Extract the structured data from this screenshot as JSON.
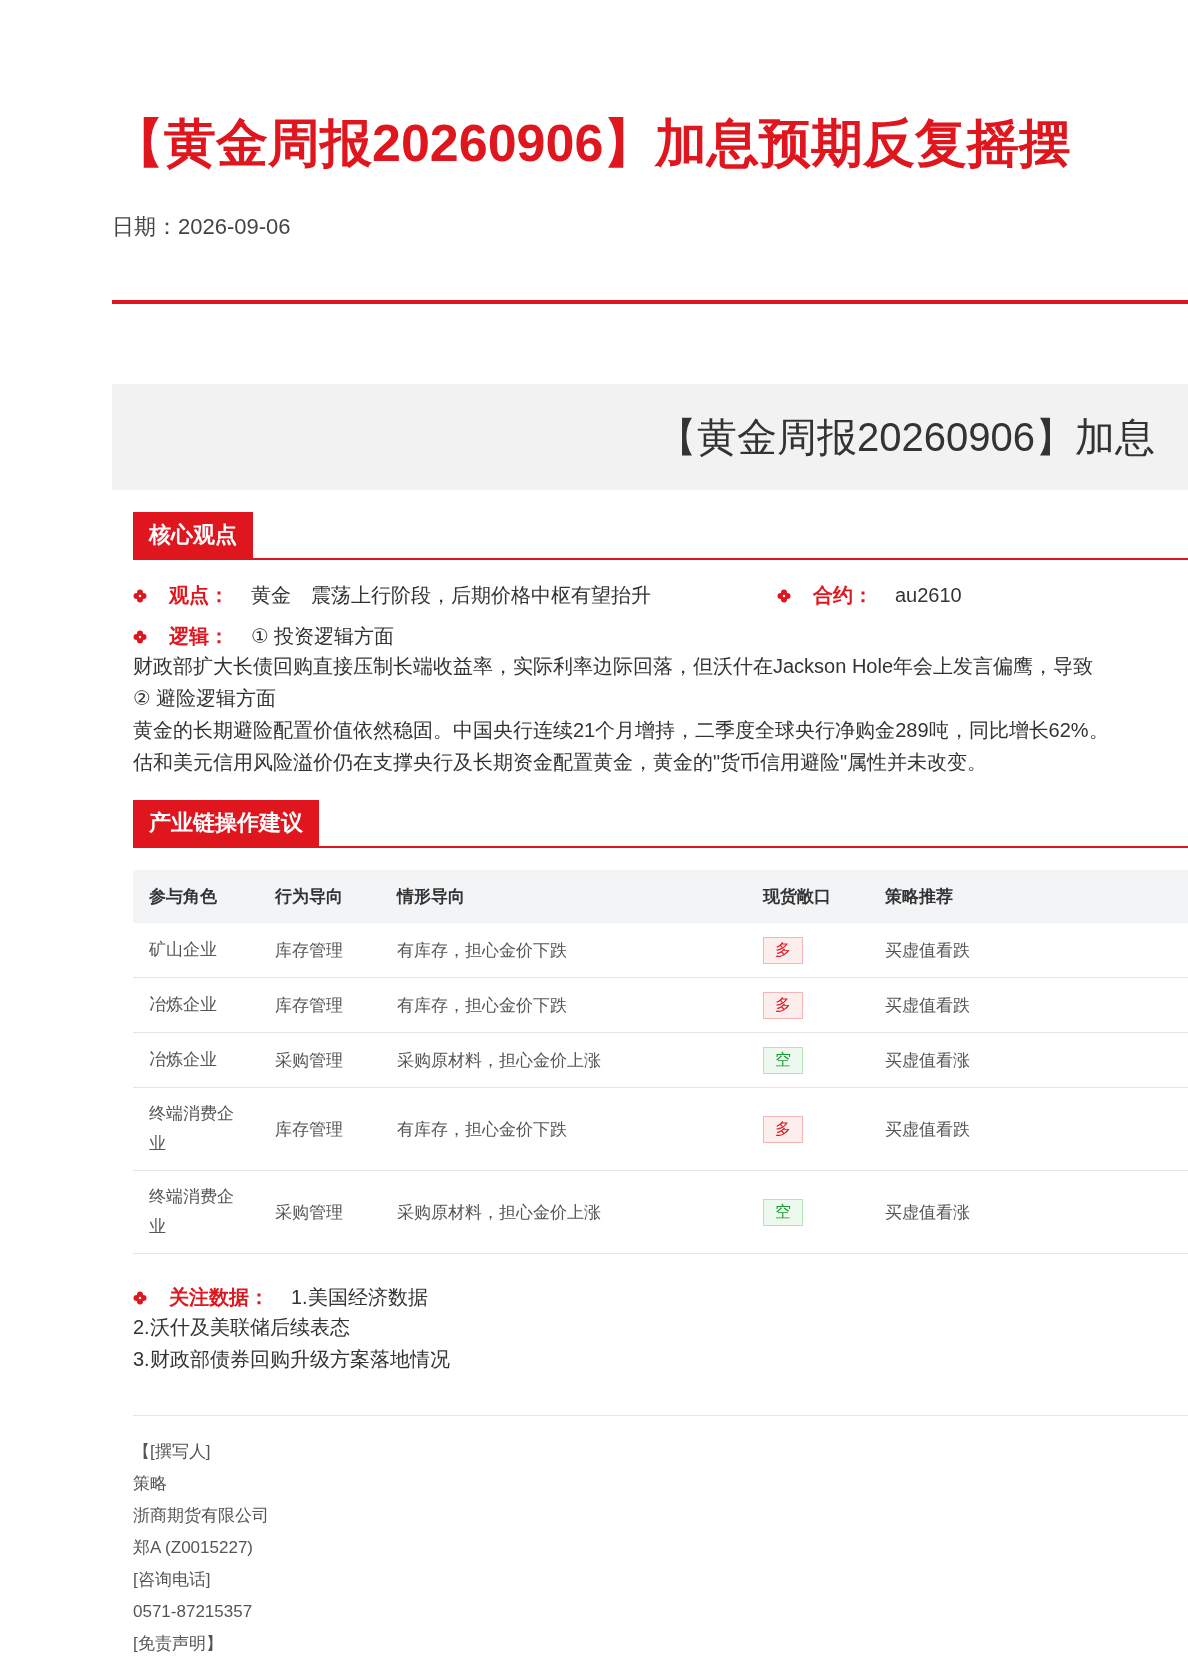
{
  "title": "【黄金周报20260906】加息预期反复摇摆",
  "date": "日期：2026-09-06",
  "banner_title": "【黄金周报20260906】加息",
  "core": {
    "heading": "核心观点",
    "view": {
      "label": "观点：",
      "subject": "黄金",
      "text": "震荡上行阶段，后期价格中枢有望抬升"
    },
    "contract": {
      "label": "合约：",
      "value": "au2610"
    },
    "logic": {
      "label": "逻辑：",
      "first": "① 投资逻辑方面",
      "lines": [
        {
          "kind": "text",
          "text": "财政部扩大长债回购直接压制长端收益率，实际利率边际回落，但沃什在Jackson Hole年会上发言偏鹰，导致"
        },
        {
          "kind": "text",
          "text": "② 避险逻辑方面"
        },
        {
          "kind": "text",
          "text": "黄金的长期避险配置价值依然稳固。中国央行连续21个月增持，二季度全球央行净购金289吨，同比增长62%。"
        },
        {
          "kind": "text",
          "text": "估和美元信用风险溢价仍在支撑央行及长期资金配置黄金，黄金的\"货币信用避险\"属性并未改变。"
        }
      ]
    }
  },
  "chain": {
    "heading": "产业链操作建议",
    "columns": [
      "参与角色",
      "行为导向",
      "情形导向",
      "现货敞口",
      "策略推荐"
    ],
    "rows": [
      {
        "role": "矿山企业",
        "behavior": "库存管理",
        "situation": "有库存，担心金价下跌",
        "exposure": {
          "text": "多",
          "kind": "long"
        },
        "strategy": "买虚值看跌"
      },
      {
        "role": "冶炼企业",
        "behavior": "库存管理",
        "situation": "有库存，担心金价下跌",
        "exposure": {
          "text": "多",
          "kind": "long"
        },
        "strategy": "买虚值看跌"
      },
      {
        "role": "冶炼企业",
        "behavior": "采购管理",
        "situation": "采购原材料，担心金价上涨",
        "exposure": {
          "text": "空",
          "kind": "short"
        },
        "strategy": "买虚值看涨"
      },
      {
        "role": "终端消费企业",
        "behavior": "库存管理",
        "situation": "有库存，担心金价下跌",
        "exposure": {
          "text": "多",
          "kind": "long"
        },
        "strategy": "买虚值看跌"
      },
      {
        "role": "终端消费企业",
        "behavior": "采购管理",
        "situation": "采购原材料，担心金价上涨",
        "exposure": {
          "text": "空",
          "kind": "short"
        },
        "strategy": "买虚值看涨"
      }
    ]
  },
  "focus": {
    "label": "关注数据：",
    "first": "1.美国经济数据",
    "items": [
      "2.沃什及美联储后续表态",
      "3.财政部债券回购升级方案落地情况"
    ]
  },
  "footer": [
    "【[撰写人]",
    "策略",
    "浙商期货有限公司",
    "郑A (Z0015227)",
    "[咨询电话]",
    "0571-87215357",
    "[免责声明】"
  ]
}
